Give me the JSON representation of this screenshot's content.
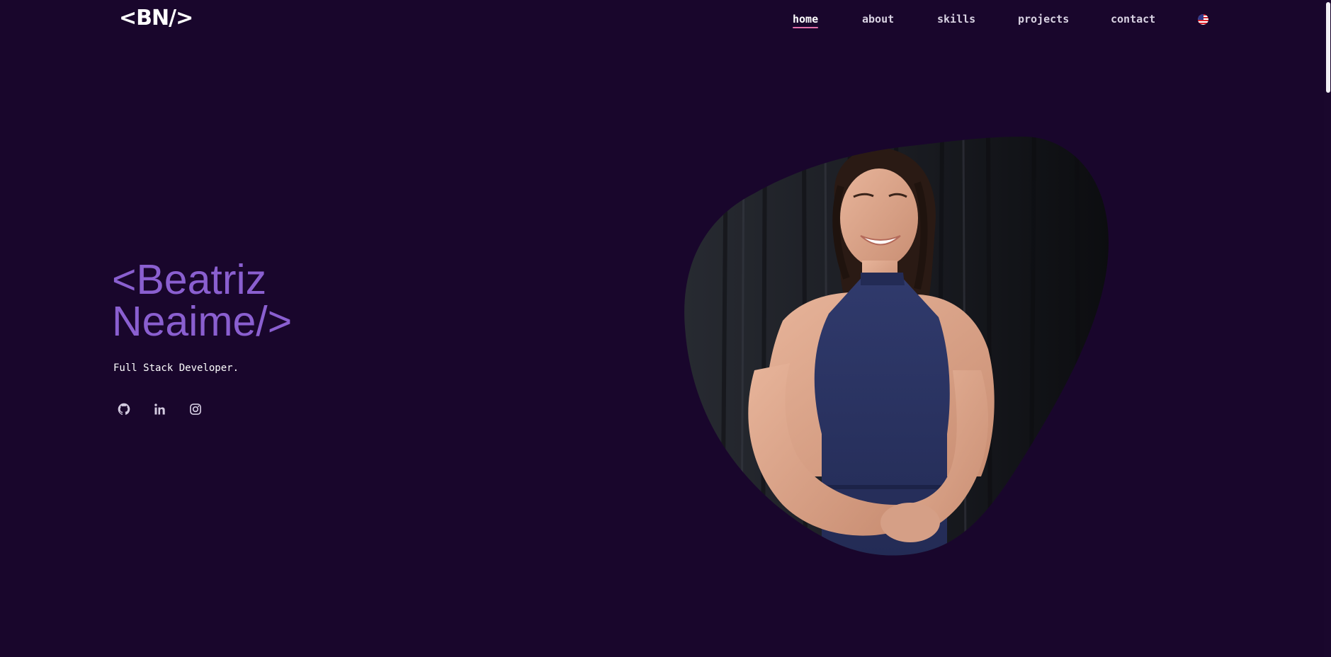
{
  "header": {
    "logo_text": "<BN/>"
  },
  "nav": {
    "items": [
      {
        "label": "home",
        "active": true
      },
      {
        "label": "about",
        "active": false
      },
      {
        "label": "skills",
        "active": false
      },
      {
        "label": "projects",
        "active": false
      },
      {
        "label": "contact",
        "active": false
      }
    ],
    "language_icon": "us-flag-icon"
  },
  "hero": {
    "title_line1": "<Beatriz",
    "title_line2": "Neaime/>",
    "subtitle": "Full Stack Developer.",
    "socials": [
      {
        "icon": "github-icon"
      },
      {
        "icon": "linkedin-icon"
      },
      {
        "icon": "instagram-icon"
      }
    ],
    "portrait": {
      "description_icon": "portrait-photo",
      "background_color": "#17181d",
      "dress_color": "#2c3566"
    }
  },
  "colors": {
    "background": "#19062c",
    "accent_purple": "#8a5fd0",
    "nav_underline": "#e36fa9",
    "text_white": "#ffffff"
  }
}
